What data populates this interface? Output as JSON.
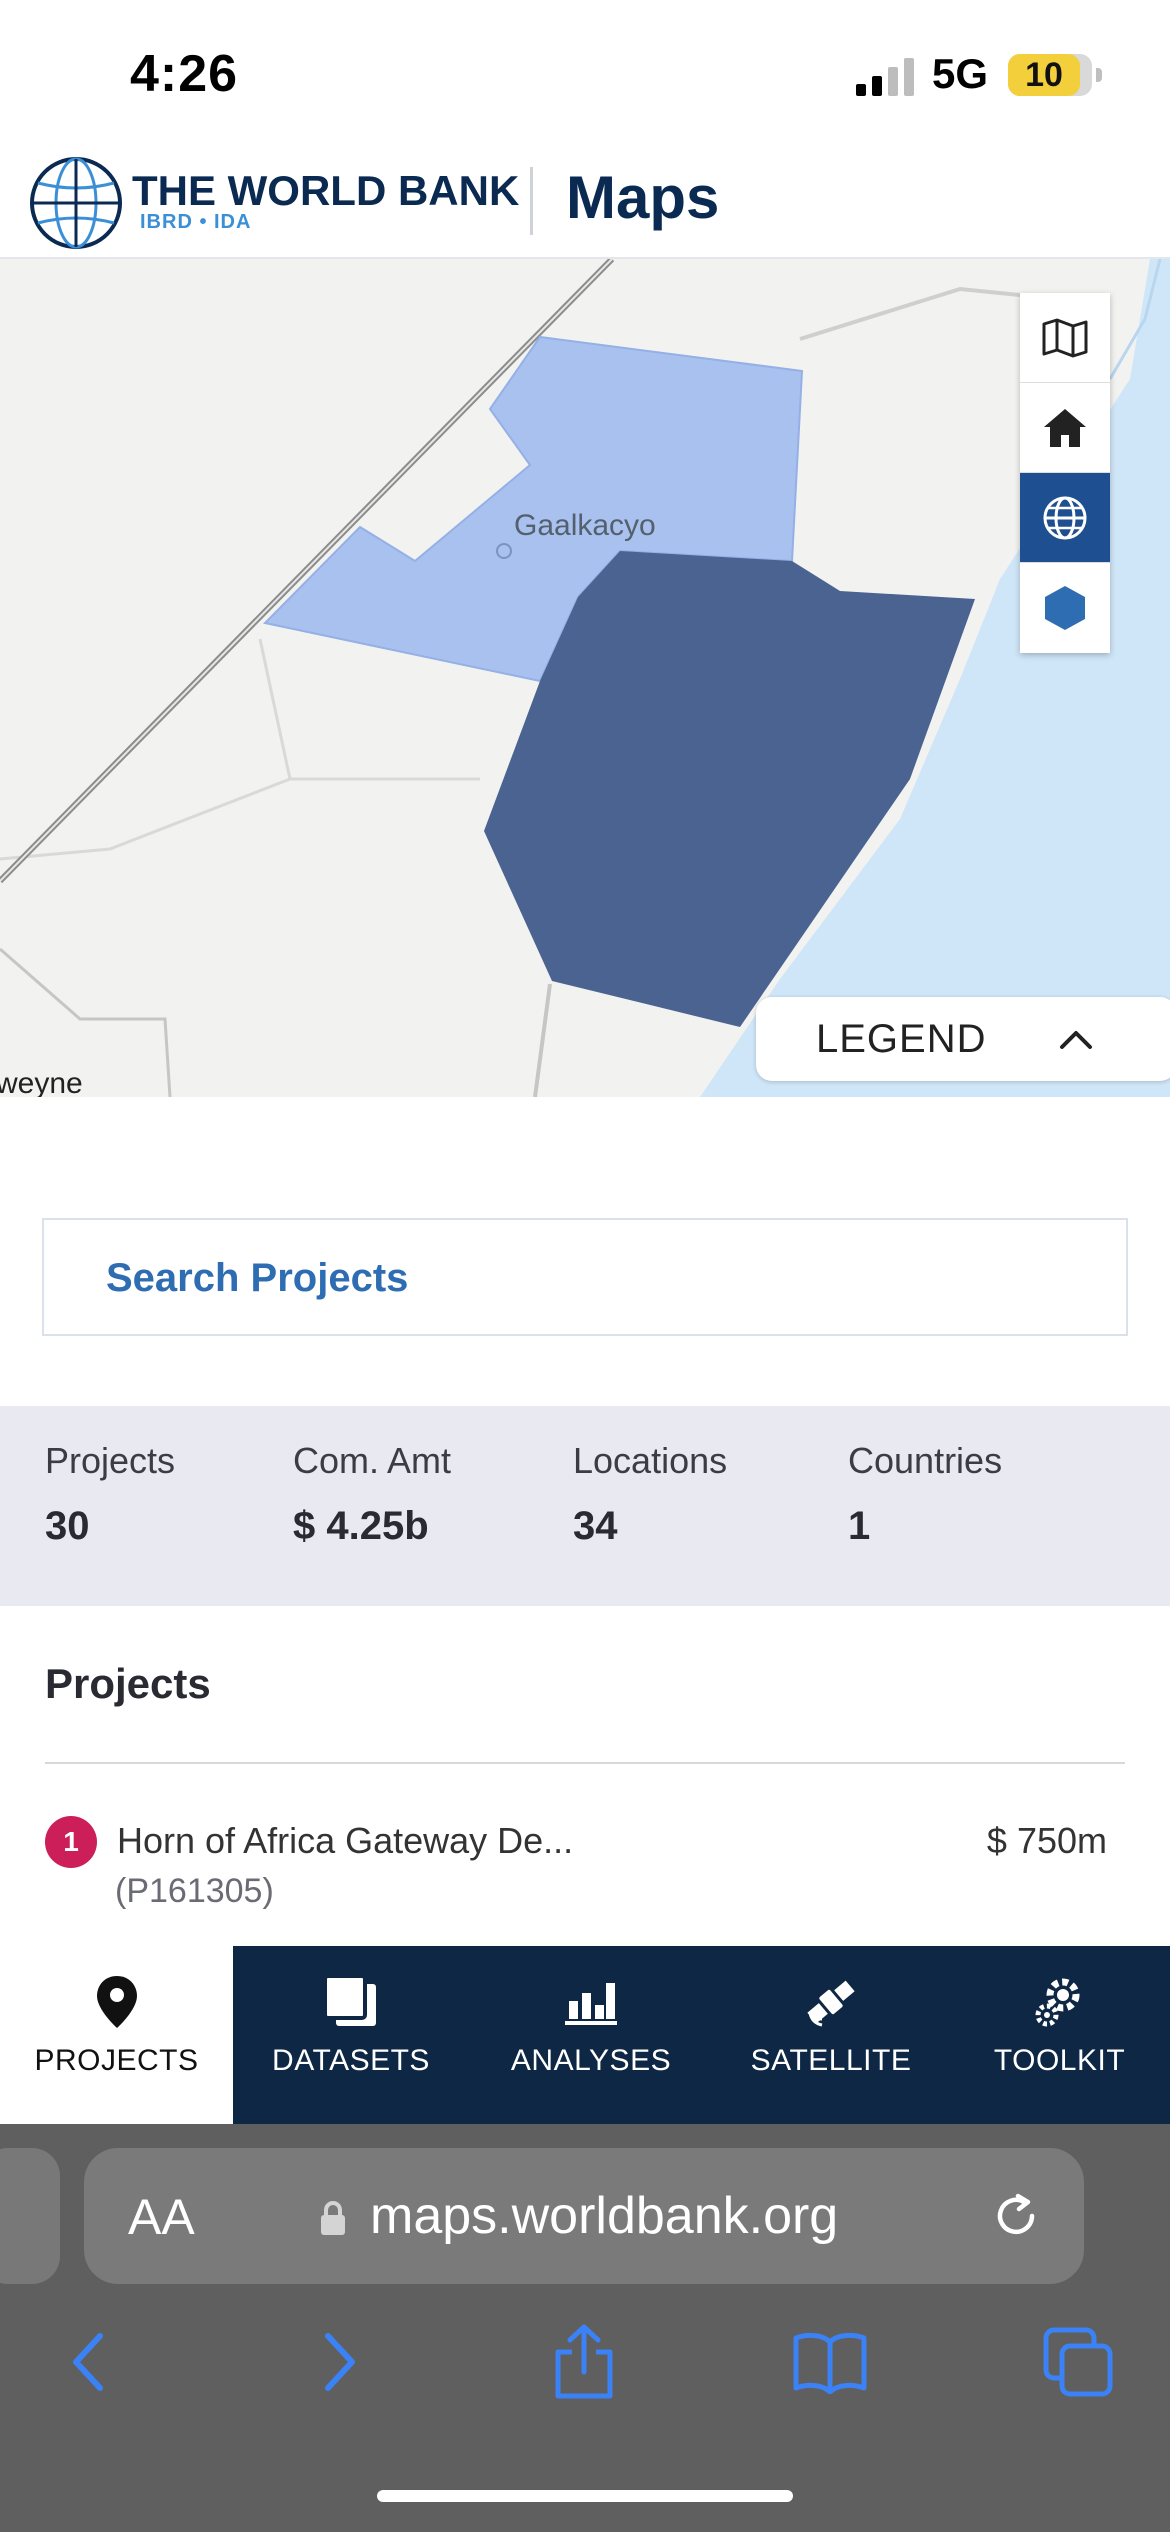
{
  "status_bar": {
    "time": "4:26",
    "network": "5G",
    "battery": "10"
  },
  "header": {
    "org_name": "THE WORLD BANK",
    "org_sub": "IBRD • IDA",
    "app_title": "Maps"
  },
  "map": {
    "place_label": "Gaalkacyo",
    "edge_label": "weyne",
    "controls": [
      "map-icon",
      "home-icon",
      "globe-icon",
      "hexagon-icon"
    ],
    "active_control": "globe-icon",
    "legend_label": "LEGEND",
    "colors": {
      "light_region": "#a9c1ee",
      "dark_region": "#4a6390",
      "water": "#cfe6f8",
      "land": "#f2f2f0"
    }
  },
  "search": {
    "placeholder": "Search Projects"
  },
  "stats": [
    {
      "label": "Projects",
      "value": "30"
    },
    {
      "label": "Com. Amt",
      "value": "$ 4.25b"
    },
    {
      "label": "Locations",
      "value": "34"
    },
    {
      "label": "Countries",
      "value": "1"
    }
  ],
  "projects": {
    "heading": "Projects",
    "items": [
      {
        "index": "1",
        "title": "Horn of Africa Gateway De...",
        "id": "(P161305)",
        "amount": "$ 750m"
      }
    ]
  },
  "bottom_nav": {
    "items": [
      {
        "label": "PROJECTS",
        "icon": "map-pin-icon"
      },
      {
        "label": "DATASETS",
        "icon": "layers-icon"
      },
      {
        "label": "ANALYSES",
        "icon": "bar-chart-icon"
      },
      {
        "label": "SATELLITE",
        "icon": "satellite-icon"
      },
      {
        "label": "TOOLKIT",
        "icon": "gear-icon"
      }
    ],
    "active": "PROJECTS"
  },
  "browser": {
    "text_size_label": "AA",
    "url": "maps.worldbank.org"
  }
}
